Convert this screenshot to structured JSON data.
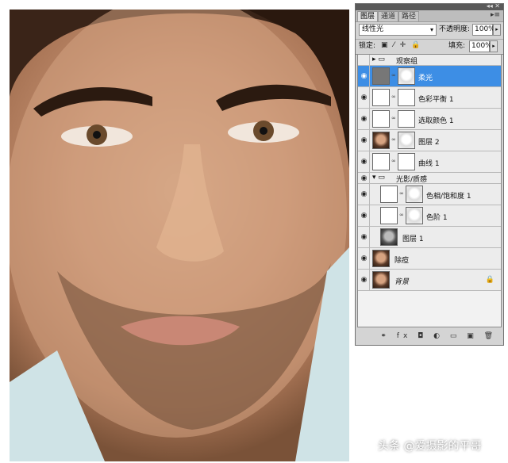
{
  "panel": {
    "tabs": [
      "图层",
      "通道",
      "路径"
    ],
    "blend_mode": "线性光",
    "opacity_label": "不透明度:",
    "opacity_value": "100%",
    "lock_label": "锁定:",
    "lock_icons": "▣ ⁄ ✛ 🔒",
    "fill_label": "填充:",
    "fill_value": "100%",
    "menu_icon": "▸≡",
    "top_controls": "◂◂ ✕",
    "bottom_icons": "⚭ fx ◘ ◐ ▭ ▣ 🗑"
  },
  "layers": [
    {
      "name": "观察组",
      "kind": "group",
      "visible": false
    },
    {
      "name": "柔光",
      "kind": "layer-dark-mask",
      "visible": true,
      "selected": true
    },
    {
      "name": "色彩平衡 1",
      "kind": "adjust-balance",
      "visible": true
    },
    {
      "name": "选取颜色 1",
      "kind": "adjust-select",
      "visible": true
    },
    {
      "name": "图层 2",
      "kind": "face-mask",
      "visible": true
    },
    {
      "name": "曲线 1",
      "kind": "adjust-curves",
      "visible": true
    },
    {
      "name": "光影/质感",
      "kind": "group-open",
      "visible": true
    },
    {
      "name": "色相/饱和度 1",
      "kind": "adjust-hue",
      "visible": true
    },
    {
      "name": "色阶 1",
      "kind": "adjust-levels",
      "visible": true
    },
    {
      "name": "图层 1",
      "kind": "face-bw",
      "visible": true
    },
    {
      "name": "除痘",
      "kind": "face",
      "visible": true
    },
    {
      "name": "背景",
      "kind": "face-bg",
      "visible": true,
      "locked": true
    }
  ],
  "watermark": "头条 @爱摄影的平哥",
  "colors": {
    "selected": "#3d8ee5",
    "panel_bg": "#d4d4d4"
  }
}
